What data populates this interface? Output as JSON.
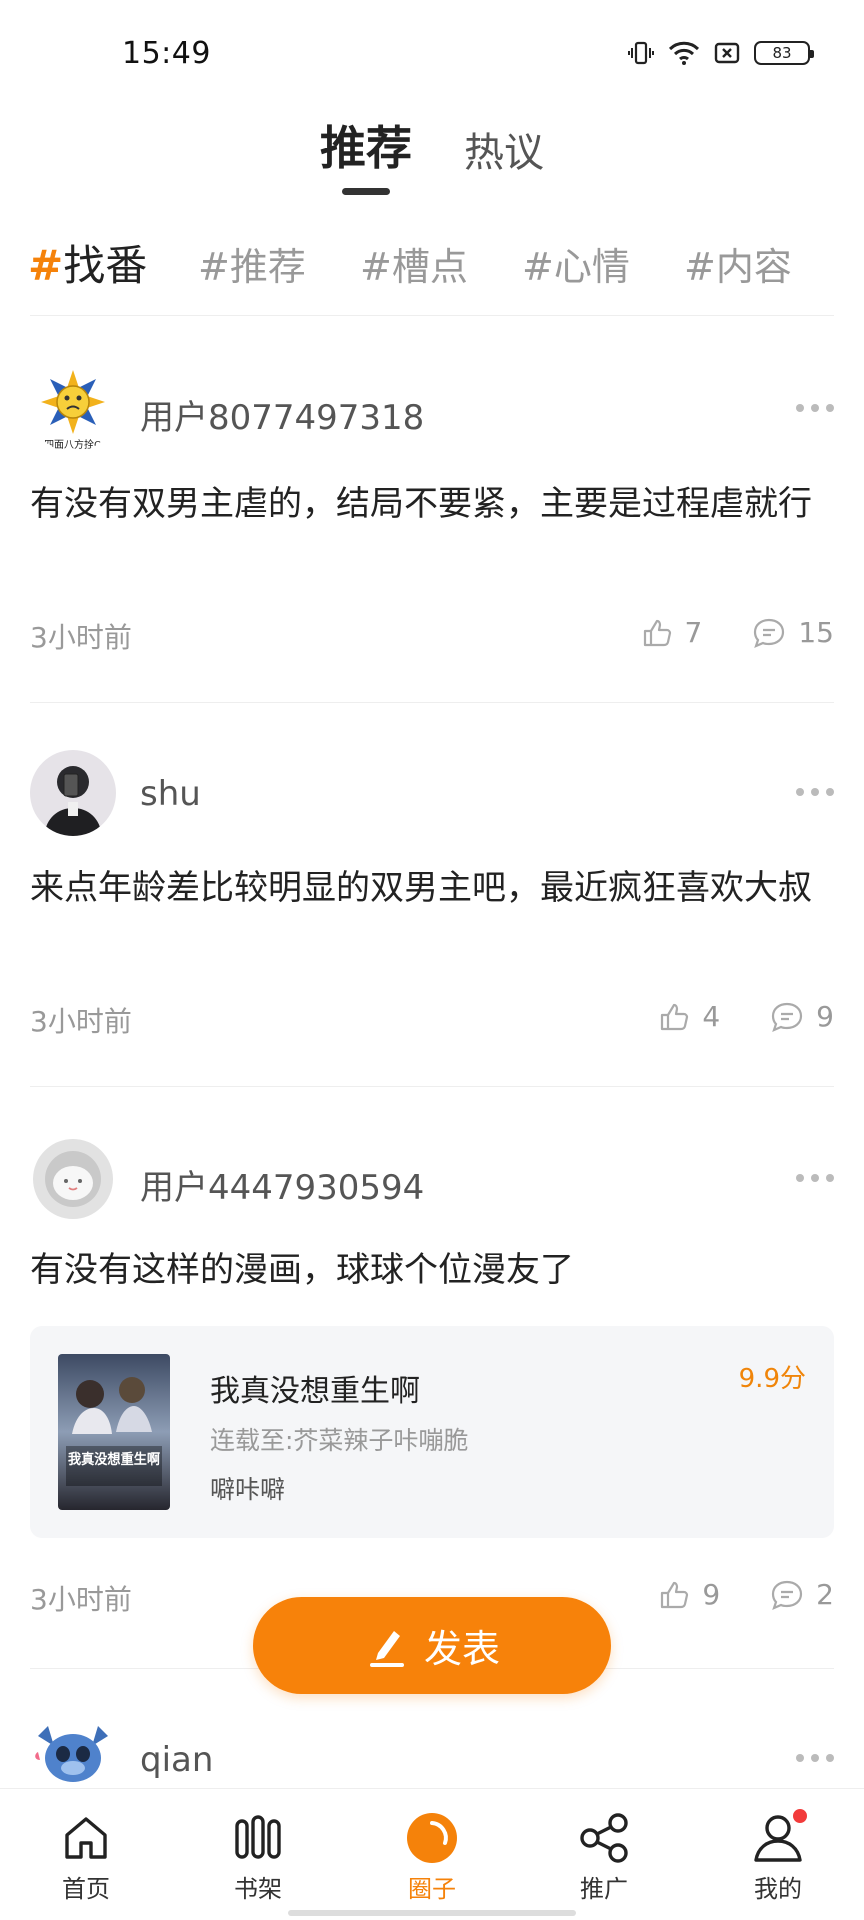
{
  "status_bar": {
    "time": "15:49",
    "battery": "83",
    "icons": [
      "vibrate-icon",
      "wifi-icon",
      "sim-off-icon",
      "battery-icon"
    ]
  },
  "top_tabs": {
    "active": "推荐",
    "other": "热议"
  },
  "tags": {
    "active_hash": "#",
    "active_label": "找番",
    "items": [
      "#推荐",
      "#槽点",
      "#心情",
      "#内容"
    ]
  },
  "posts": [
    {
      "username": "用户8077497318",
      "avatar_text": "四面八方拴Q",
      "text": "有没有双男主虐的，结局不要紧，主要是过程虐就行",
      "time": "3小时前",
      "likes": "7",
      "comments": "15"
    },
    {
      "username": "shu",
      "text": "来点年龄差比较明显的双男主吧，最近疯狂喜欢大叔",
      "time": "3小时前",
      "likes": "4",
      "comments": "9"
    },
    {
      "username": "用户4447930594",
      "text": "有没有这样的漫画，球球个位漫友了",
      "time": "3小时前",
      "likes": "9",
      "comments": "2",
      "book": {
        "title": "我真没想重生啊",
        "subtitle": "连载至:芥菜辣子咔嘣脆",
        "author": "噼咔噼",
        "score": "9.9分",
        "cover_text": "我真没想重生啊"
      }
    },
    {
      "username": "qian"
    }
  ],
  "fab": {
    "label": "发表"
  },
  "nav": [
    {
      "label": "首页",
      "icon": "home-icon"
    },
    {
      "label": "书架",
      "icon": "bookshelf-icon"
    },
    {
      "label": "圈子",
      "icon": "circle-icon",
      "active": true
    },
    {
      "label": "推广",
      "icon": "share-icon"
    },
    {
      "label": "我的",
      "icon": "profile-icon"
    }
  ],
  "colors": {
    "accent": "#f5820a",
    "badge": "#f23b3b"
  }
}
